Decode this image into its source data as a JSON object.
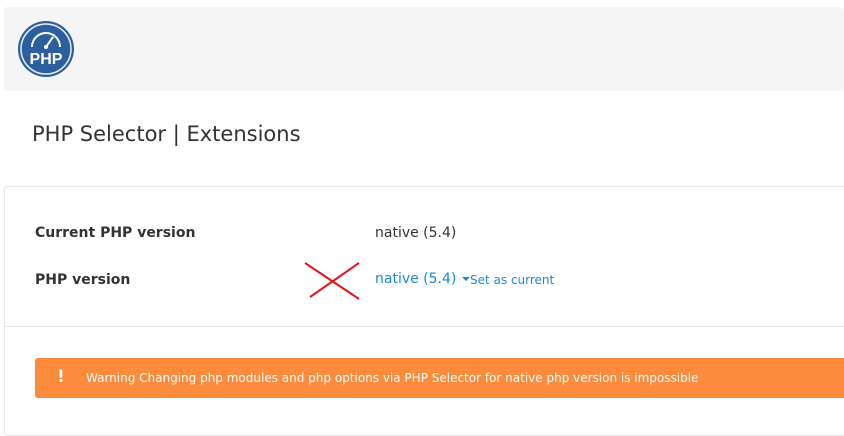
{
  "header": {
    "logo_text": "PHP"
  },
  "page": {
    "title": "PHP Selector | Extensions"
  },
  "settings": {
    "current_version_label": "Current PHP version",
    "current_version_value": "native (5.4)",
    "php_version_label": "PHP version",
    "php_version_selected": "native (5.4)",
    "set_as_current_label": "Set as current"
  },
  "warning": {
    "icon": "!",
    "text": "Warning Changing php modules and php options via PHP Selector for native php version is impossible"
  },
  "colors": {
    "link": "#1a8ad3",
    "warning_bg": "#fd8b3e",
    "logo_bg": "#2b5f9e",
    "annotation_red": "#e8141c"
  }
}
